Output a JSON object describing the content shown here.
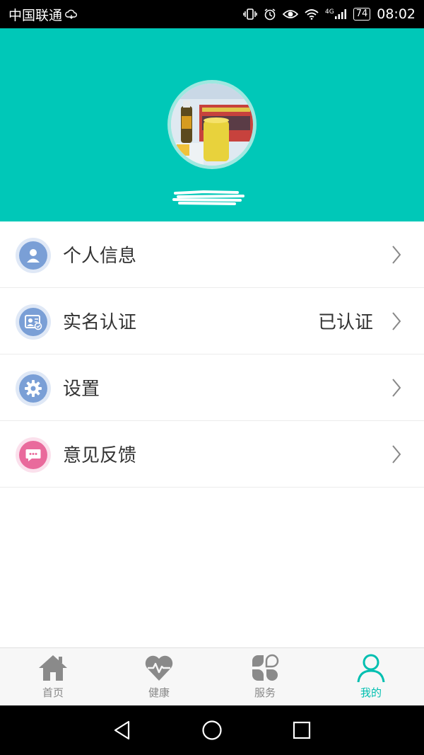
{
  "status_bar": {
    "carrier": "中国联通",
    "network": "4G",
    "battery": "74",
    "time": "08:02"
  },
  "menu": {
    "items": [
      {
        "label": "个人信息",
        "value": "",
        "icon": "person-icon",
        "color": "#7a9fd6"
      },
      {
        "label": "实名认证",
        "value": "已认证",
        "icon": "id-card-icon",
        "color": "#7a9fd6"
      },
      {
        "label": "设置",
        "value": "",
        "icon": "gear-icon",
        "color": "#7a9fd6"
      },
      {
        "label": "意见反馈",
        "value": "",
        "icon": "chat-bubble-icon",
        "color": "#e96a9c"
      }
    ]
  },
  "bottom_nav": {
    "items": [
      {
        "label": "首页",
        "icon": "home-icon",
        "active": false
      },
      {
        "label": "健康",
        "icon": "heart-pulse-icon",
        "active": false
      },
      {
        "label": "服务",
        "icon": "grid-petals-icon",
        "active": false
      },
      {
        "label": "我的",
        "icon": "user-outline-icon",
        "active": true
      }
    ]
  },
  "colors": {
    "header_bg": "#00c8b8",
    "accent": "#00bfb0",
    "inactive_nav": "#888888"
  }
}
